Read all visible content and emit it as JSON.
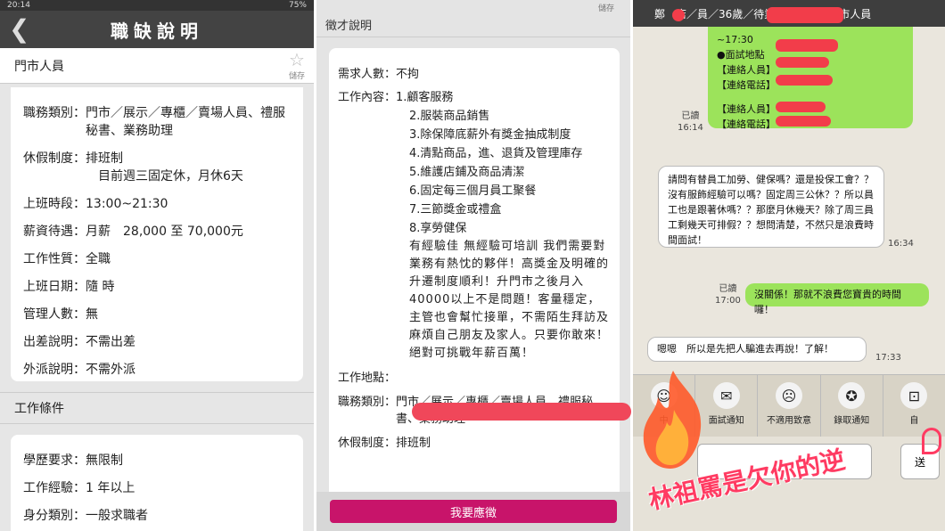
{
  "panel1": {
    "status": {
      "time": "20:14",
      "battery": "75%"
    },
    "nav_title": "職缺說明",
    "job_title": "門市人員",
    "fav_label": "儲存",
    "details": [
      {
        "key": "職務類別：",
        "value": "門市／展示／專櫃／賣場人員、禮服秘書、業務助理"
      },
      {
        "key": "休假制度：",
        "value": "排班制"
      },
      {
        "key": "",
        "value": "目前週三固定休，月休6天"
      },
      {
        "key": "上班時段：",
        "value": "13:00~21:30"
      },
      {
        "key": "薪資待遇：",
        "value": "月薪　28,000 至 70,000元"
      },
      {
        "key": "工作性質：",
        "value": "全職"
      },
      {
        "key": "上班日期：",
        "value": "隨 時"
      },
      {
        "key": "管理人數：",
        "value": "無"
      },
      {
        "key": "出差說明：",
        "value": "不需出差"
      },
      {
        "key": "外派說明：",
        "value": "不需外派"
      }
    ],
    "section_title": "工作條件",
    "conditions": [
      {
        "key": "學歷要求：",
        "value": "無限制"
      },
      {
        "key": "工作經驗：",
        "value": "1 年以上"
      },
      {
        "key": "身分類別：",
        "value": "一般求職者"
      }
    ]
  },
  "panel2": {
    "fav_label": "儲存",
    "section_title": "徵才說明",
    "headcount_key": "需求人數：",
    "headcount_value": "不拘",
    "content_key": "工作內容：",
    "content_items": [
      "1.顧客服務",
      "2.服裝商品銷售",
      "3.除保障底薪外有獎金抽成制度",
      "4.清點商品，進、退貨及管理庫存",
      "5.維護店鋪及商品清潔",
      "6.固定每三個月員工聚餐",
      "7.三節獎金或禮盒",
      "8.享勞健保"
    ],
    "description": "有經驗佳 無經驗可培訓 我們需要對業務有熱忱的夥伴！高獎金及明確的升遷制度順利！升門市之後月入40000以上不是問題！客量穩定，主管也會幫忙接單，不需陌生拜訪及麻煩自己朋友及家人。只要你敢來！絕對可挑戰年薪百萬！",
    "location_key": "工作地點：",
    "category_key": "職務類別：",
    "category_value": "門市／展示／專櫃／賣場人員、禮服秘書、業務助理",
    "holiday_key": "休假制度：",
    "holiday_value": "排班制",
    "apply_label": "我要應徵"
  },
  "panel3": {
    "header": "鄭　店／員／36歲／待業中　　　　門市人員",
    "msg1_lines": [
      "~17:30",
      "●面試地點",
      "【連絡人員】",
      "【連絡電話】",
      "",
      "【連絡人員】",
      "【連絡電話】"
    ],
    "read1": "已讀",
    "time1": "16:14",
    "msg2": "請問有替員工加勞、健保嗎？還是投保工會？？沒有服飾經驗可以嗎？固定周三公休？？所以員工也是跟著休嗎？？那麼月休幾天？除了周三員工剩幾天可排假？？想問清楚，不然只是浪費時間面試！",
    "time2": "16:34",
    "read3": "已讀",
    "time3": "17:00",
    "msg3": "沒關係！那就不浪費您寶貴的時間囉！",
    "msg4": "嗯嗯　所以是先把人騙進去再說！了解！",
    "time4": "17:33",
    "tools": [
      {
        "icon": "chat-icon",
        "glyph": "☺",
        "label": "中"
      },
      {
        "icon": "interview-envelope-icon",
        "glyph": "✉",
        "label": "面試通知"
      },
      {
        "icon": "decline-icon",
        "glyph": "☹",
        "label": "不適用致意"
      },
      {
        "icon": "hire-icon",
        "glyph": "✪",
        "label": "錄取通知"
      },
      {
        "icon": "more-icon",
        "glyph": "⊡",
        "label": "自"
      }
    ],
    "send_label": "送",
    "caption": "林祖罵是欠你的逆",
    "accent": "#ff3b62"
  }
}
